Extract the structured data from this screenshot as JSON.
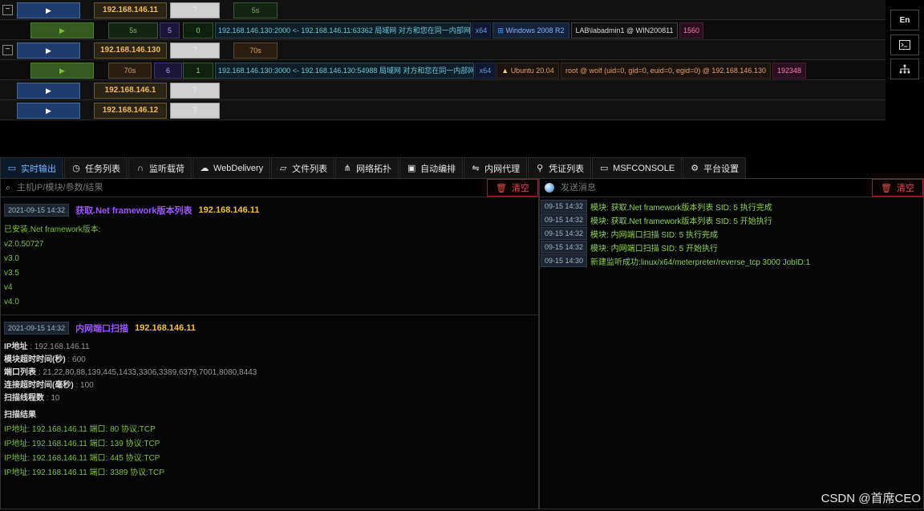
{
  "hosts": [
    {
      "ip": "192.168.146.11",
      "host": "?",
      "time": "5s",
      "expander": "−"
    },
    {
      "time": "5s",
      "sid": "5",
      "num": "0",
      "connection": "192.168.146.130:2000 <- 192.168.146.11:63362 局域网 对方和您在同一内部网",
      "arch": "x64",
      "os": "Windows 2008 R2",
      "user": "LAB\\labadmin1 @ WIN200811",
      "pid": "1560"
    },
    {
      "ip": "192.168.146.130",
      "host": "?",
      "time": "70s",
      "expander": "−"
    },
    {
      "time": "70s",
      "sid": "6",
      "num": "1",
      "connection": "192.168.146.130:3000 <- 192.168.146.130:54988 局域网 对方和您在同一内部网",
      "arch": "x64",
      "os": "Ubuntu 20.04",
      "user": "root @ wolf (uid=0, gid=0, euid=0, egid=0) @ 192.168.146.130",
      "pid": "192348"
    },
    {
      "ip": "192.168.146.1",
      "host": "?"
    },
    {
      "ip": "192.168.146.12",
      "host": "?"
    }
  ],
  "side_buttons": {
    "lang": "En"
  },
  "tabs": [
    {
      "label": "实时输出",
      "icon": "monitor-icon"
    },
    {
      "label": "任务列表",
      "icon": "clock-icon"
    },
    {
      "label": "监听载荷",
      "icon": "headphones-icon"
    },
    {
      "label": "WebDelivery",
      "icon": "cloud-icon"
    },
    {
      "label": "文件列表",
      "icon": "folder-icon"
    },
    {
      "label": "网络拓扑",
      "icon": "network-icon"
    },
    {
      "label": "自动编排",
      "icon": "robot-icon"
    },
    {
      "label": "内网代理",
      "icon": "proxy-icon"
    },
    {
      "label": "凭证列表",
      "icon": "key-icon"
    },
    {
      "label": "MSFCONSOLE",
      "icon": "terminal-icon"
    },
    {
      "label": "平台设置",
      "icon": "gear-icon"
    }
  ],
  "left": {
    "search_placeholder": "主机IP/模块/参数/结果",
    "clear_label": "清空",
    "blocks": [
      {
        "time": "2021-09-15 14:32",
        "title": "获取.Net framework版本列表",
        "ip": "192.168.146.11",
        "lines": [
          "已安装.Net framework版本:",
          "v2.0.50727",
          "v3.0",
          "v3.5",
          "v4",
          "v4.0"
        ]
      },
      {
        "time": "2021-09-15 14:32",
        "title": "内网端口扫描",
        "ip": "192.168.146.11",
        "params": [
          {
            "k": "IP地址",
            "v": "192.168.146.11"
          },
          {
            "k": "模块超时时间(秒)",
            "v": "600"
          },
          {
            "k": "端口列表",
            "v": "21,22,80,88,139,445,1433,3306,3389,6379,7001,8080,8443"
          },
          {
            "k": "连接超时时间(毫秒)",
            "v": "100"
          },
          {
            "k": "扫描线程数",
            "v": "10"
          }
        ],
        "result_title": "扫描结果",
        "results": [
          "IP地址: 192.168.146.11 端口: 80 协议:TCP",
          "IP地址: 192.168.146.11 端口: 139 协议:TCP",
          "IP地址: 192.168.146.11 端口: 445 协议:TCP",
          "IP地址: 192.168.146.11 端口: 3389 协议:TCP"
        ]
      }
    ]
  },
  "right": {
    "placeholder": "发送消息",
    "clear_label": "清空",
    "messages": [
      {
        "time": "09-15 14:32",
        "text": "模块: 获取.Net framework版本列表 SID: 5 执行完成"
      },
      {
        "time": "09-15 14:32",
        "text": "模块: 获取.Net framework版本列表 SID: 5 开始执行"
      },
      {
        "time": "09-15 14:32",
        "text": "模块: 内网端口扫描 SID: 5 执行完成"
      },
      {
        "time": "09-15 14:32",
        "text": "模块: 内网端口扫描 SID: 5 开始执行"
      },
      {
        "time": "09-15 14:30",
        "text": "新建监听成功:linux/x64/meterpreter/reverse_tcp 3000 JobID:1"
      }
    ]
  },
  "watermark": "CSDN @首席CEO"
}
